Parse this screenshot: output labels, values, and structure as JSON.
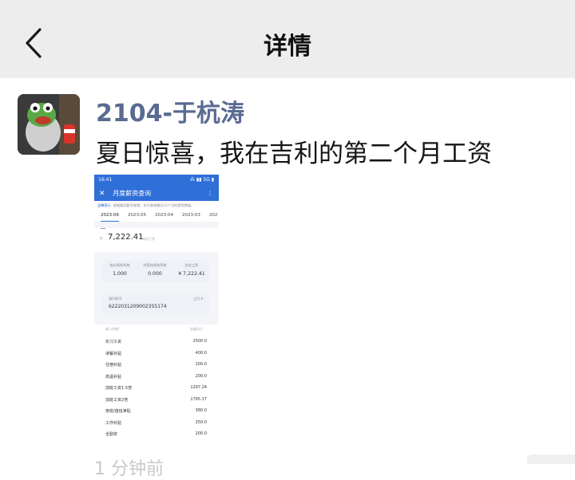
{
  "nav": {
    "title": "详情"
  },
  "post": {
    "username": "2104-于杭涛",
    "text": "夏日惊喜，我在吉利的第二个月工资"
  },
  "phone": {
    "status_time": "16:41",
    "status_right": "⁂ ▮▮ 5G ▮",
    "header_title": "月度薪资查询",
    "notice_label": "温馨提示",
    "notice_text": "根据集团薪资政策，仅可查询最近12个月的薪资数据。",
    "tabs": [
      "2023-06",
      "2023-05",
      "2023-04",
      "2023-03",
      "202"
    ],
    "currency": "¥",
    "total": "7,222.41",
    "total_label": "实际工资",
    "card1": {
      "cols": [
        {
          "label": "岗位绩效系数",
          "value": "1.000"
        },
        {
          "label": "经营体绩效系数",
          "value": "0.000"
        },
        {
          "label": "应发工资",
          "value": "¥ 7,222.41"
        }
      ]
    },
    "card2": {
      "label": "银行账号",
      "number": "6222031209002355174",
      "right": "工行卡"
    },
    "list_header_left": "收入明细",
    "list_header_right": "金额(元)",
    "items": [
      {
        "name": "实习工资",
        "value": "2500.0"
      },
      {
        "name": "误餐补贴",
        "value": "400.0"
      },
      {
        "name": "住宿补贴",
        "value": "200.0"
      },
      {
        "name": "高温补贴",
        "value": "200.0"
      },
      {
        "name": "加班工资1.5倍",
        "value": "1297.24"
      },
      {
        "name": "加班工资2倍",
        "value": "1795.17"
      },
      {
        "name": "夜班/值班津贴",
        "value": "380.0"
      },
      {
        "name": "工作补贴",
        "value": "250.0"
      },
      {
        "name": "全勤奖",
        "value": "200.0"
      }
    ]
  },
  "bottom_text": "1 分钟前"
}
